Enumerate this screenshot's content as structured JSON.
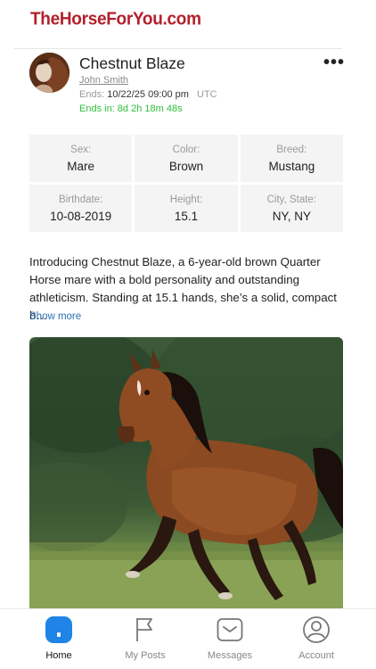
{
  "header": {
    "logo_text": "TheHorseForYou.com"
  },
  "listing": {
    "title": "Chestnut Blaze",
    "seller": "John Smith",
    "ends_label": "Ends:",
    "ends_date": "10/22/25 09:00 pm",
    "timezone": "UTC",
    "countdown": "Ends in: 8d 2h 18m 48s",
    "more_menu": "•••"
  },
  "details": [
    {
      "label": "Sex:",
      "value": "Mare"
    },
    {
      "label": "Color:",
      "value": "Brown"
    },
    {
      "label": "Breed:",
      "value": "Mustang"
    },
    {
      "label": "Birthdate:",
      "value": "10-08-2019"
    },
    {
      "label": "Height:",
      "value": "15.1"
    },
    {
      "label": "City, State:",
      "value": "NY, NY"
    }
  ],
  "description": {
    "text": "Introducing Chestnut Blaze, a 6-year-old brown Quarter Horse mare with a bold personality and outstanding athleticism. Standing at 15.1 hands, she’s a solid, compact b…",
    "show_more": "Show more"
  },
  "tabs": [
    {
      "label": "Home",
      "icon": "home-icon",
      "active": true
    },
    {
      "label": "My Posts",
      "icon": "flag-icon",
      "active": false
    },
    {
      "label": "Messages",
      "icon": "envelope-icon",
      "active": false
    },
    {
      "label": "Account",
      "icon": "user-circle-icon",
      "active": false
    }
  ],
  "colors": {
    "brand_red": "#b3202b",
    "countdown_green": "#2fbf3d",
    "link_blue": "#2a6fb5",
    "active_tab_blue": "#1f84e6"
  }
}
